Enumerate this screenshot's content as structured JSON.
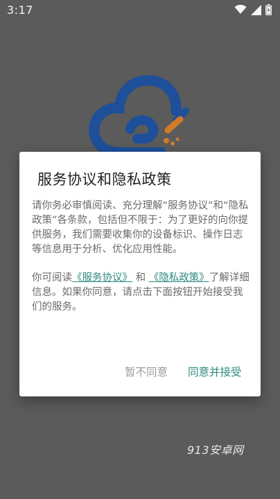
{
  "status_bar": {
    "time": "3:17",
    "icons": [
      "wifi-icon",
      "signal-icon",
      "battery-icon"
    ]
  },
  "logo": {
    "icon": "cloud-logo-icon",
    "colors": {
      "primary": "#1d4f9a",
      "accent": "#d07a2a"
    }
  },
  "dialog": {
    "title": "服务协议和隐私政策",
    "para1": "请你务必审慎阅读、充分理解“服务协议”和“隐私政策”各条款，包括但不限于：为了更好的向你提供服务，我们需要收集你的设备标识、操作日志等信息用于分析、优化应用性能。",
    "para2_prefix": "你可阅读",
    "link_service": "《服务协议》",
    "para2_and": " 和 ",
    "link_privacy": "《隐私政策》",
    "para2_suffix": "了解详细信息。如果你同意，请点击下面按钮开始接受我们的服务。",
    "disagree_label": "暂不同意",
    "agree_label": "同意并接受",
    "accent_color": "#2e8a7e"
  },
  "watermark": "913安卓网"
}
